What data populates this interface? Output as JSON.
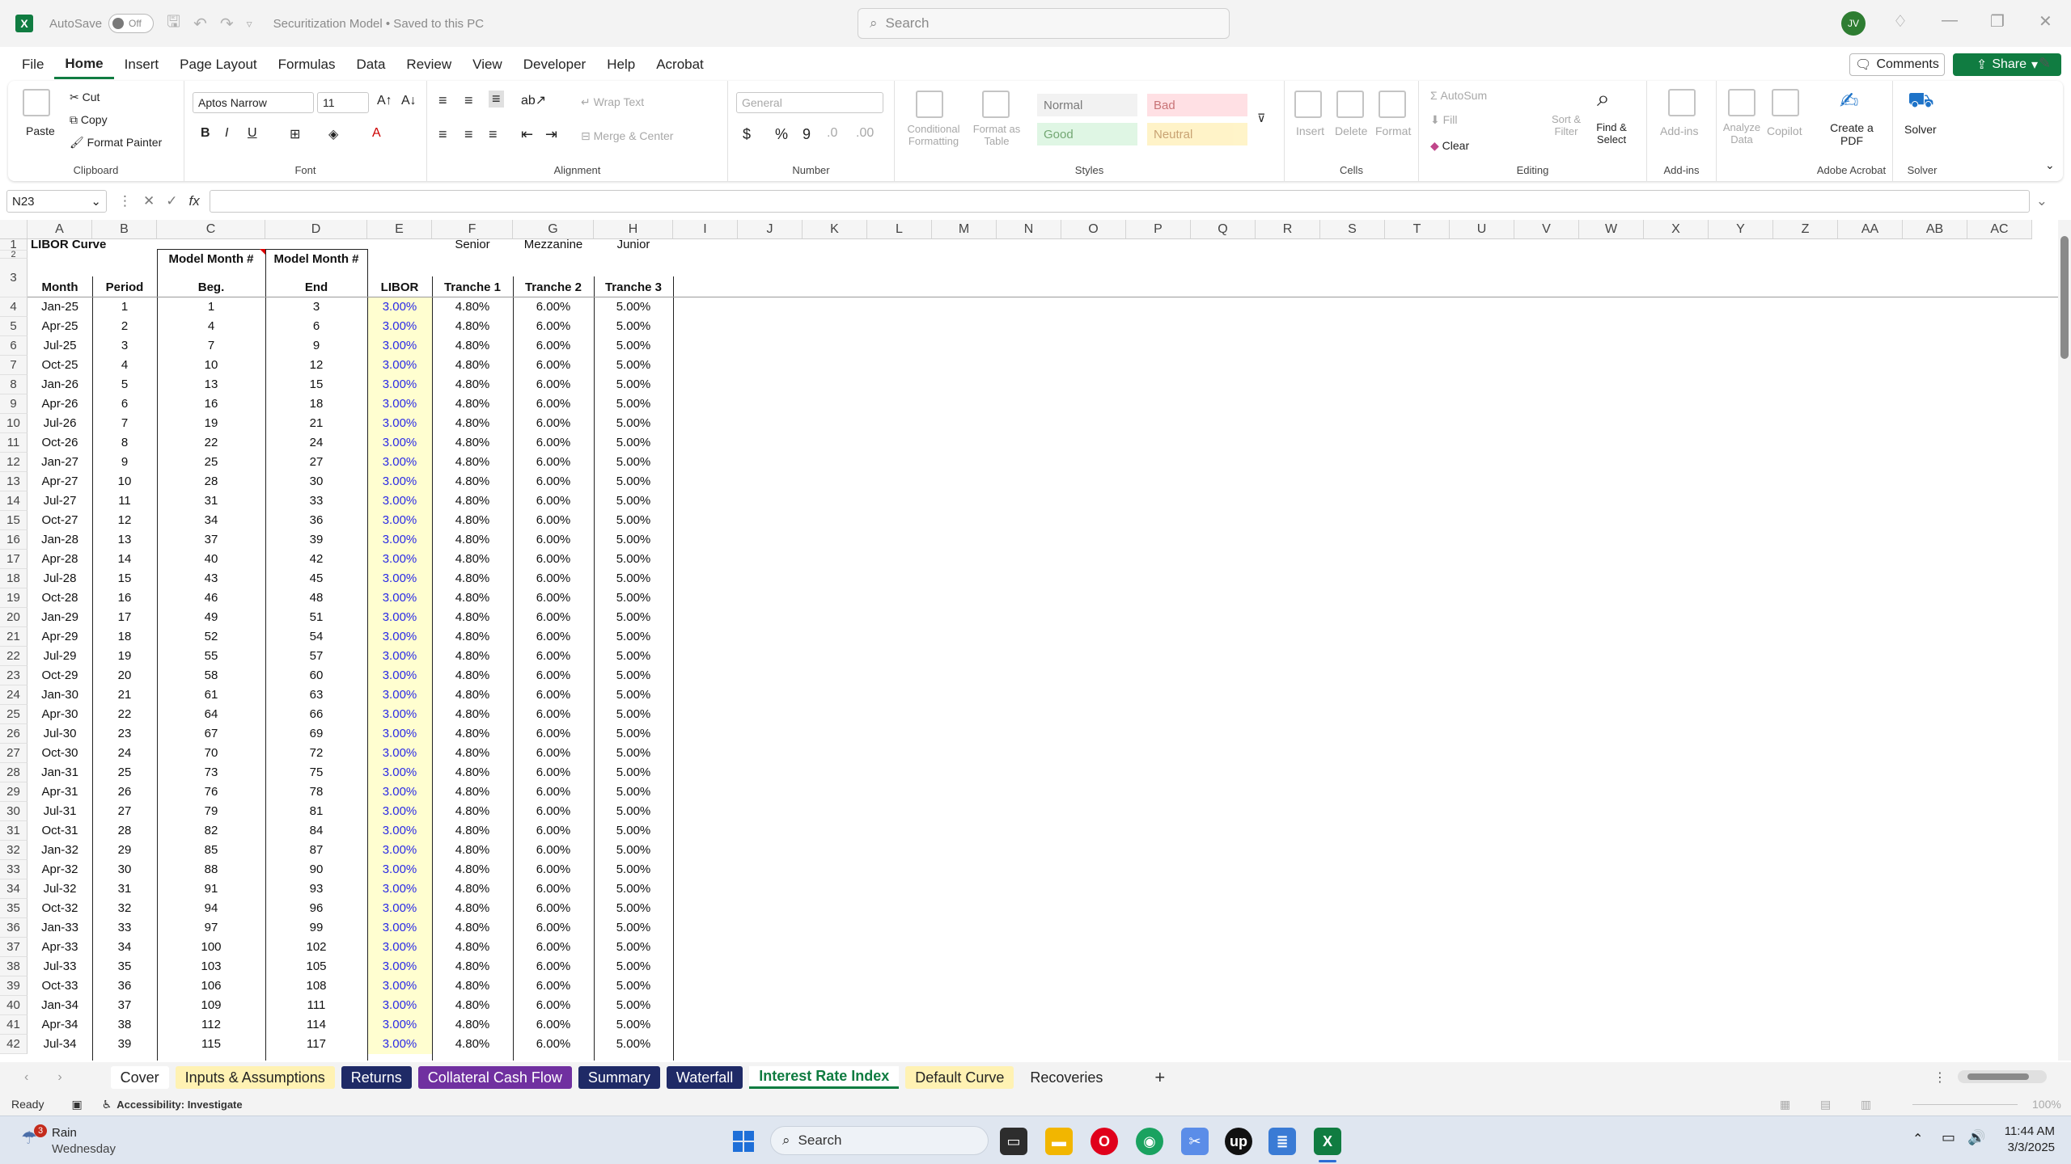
{
  "titlebar": {
    "autosave_label": "AutoSave",
    "autosave_state": "Off",
    "doc_title": "Securitization Model • Saved to this PC",
    "search_placeholder": "Search",
    "avatar_initials": "JV"
  },
  "menu": [
    "File",
    "Home",
    "Insert",
    "Page Layout",
    "Formulas",
    "Data",
    "Review",
    "View",
    "Developer",
    "Help",
    "Acrobat"
  ],
  "menu_active": "Home",
  "actions": {
    "comments": "Comments",
    "share": "Share"
  },
  "ribbon": {
    "clipboard": {
      "paste": "Paste",
      "cut": "Cut",
      "copy": "Copy",
      "format_painter": "Format Painter",
      "label": "Clipboard"
    },
    "font": {
      "name": "Aptos Narrow",
      "size": "11",
      "label": "Font"
    },
    "alignment": {
      "wrap": "Wrap Text",
      "merge": "Merge & Center",
      "label": "Alignment"
    },
    "number": {
      "format": "General",
      "label": "Number"
    },
    "styles": {
      "cond": "Conditional Formatting",
      "table": "Format as Table",
      "normal": "Normal",
      "bad": "Bad",
      "good": "Good",
      "neutral": "Neutral",
      "label": "Styles"
    },
    "cells": {
      "insert": "Insert",
      "delete": "Delete",
      "format": "Format",
      "label": "Cells"
    },
    "editing": {
      "autosum": "AutoSum",
      "fill": "Fill",
      "clear": "Clear",
      "sort": "Sort & Filter",
      "find": "Find & Select",
      "label": "Editing"
    },
    "addins": {
      "addins": "Add-ins",
      "label": "Add-ins"
    },
    "analysis": {
      "analyze": "Analyze Data",
      "copilot": "Copilot"
    },
    "acrobat": {
      "create": "Create a PDF",
      "label": "Adobe Acrobat"
    },
    "solver": {
      "solver": "Solver",
      "label": "Solver"
    }
  },
  "formula_bar": {
    "name_box": "N23",
    "fx": "fx",
    "formula": ""
  },
  "columns": [
    "A",
    "B",
    "C",
    "D",
    "E",
    "F",
    "G",
    "H",
    "I",
    "J",
    "K",
    "L",
    "M",
    "N",
    "O",
    "P",
    "Q",
    "R",
    "S",
    "T",
    "U",
    "V",
    "W",
    "X",
    "Y",
    "Z",
    "AA",
    "AB",
    "AC"
  ],
  "sheet": {
    "title": "LIBOR Curve",
    "tranche_groups": [
      "Senior",
      "Mezzanine",
      "Junior"
    ],
    "headers": {
      "month": "Month",
      "period": "Period",
      "beg_1": "Model Month #",
      "beg_2": "Beg.",
      "end_1": "Model Month #",
      "end_2": "End",
      "libor": "LIBOR",
      "t1": "Tranche 1",
      "t2": "Tranche 2",
      "t3": "Tranche 3"
    },
    "rows": [
      [
        "Jan-25",
        "1",
        "1",
        "3",
        "3.00%",
        "4.80%",
        "6.00%",
        "5.00%"
      ],
      [
        "Apr-25",
        "2",
        "4",
        "6",
        "3.00%",
        "4.80%",
        "6.00%",
        "5.00%"
      ],
      [
        "Jul-25",
        "3",
        "7",
        "9",
        "3.00%",
        "4.80%",
        "6.00%",
        "5.00%"
      ],
      [
        "Oct-25",
        "4",
        "10",
        "12",
        "3.00%",
        "4.80%",
        "6.00%",
        "5.00%"
      ],
      [
        "Jan-26",
        "5",
        "13",
        "15",
        "3.00%",
        "4.80%",
        "6.00%",
        "5.00%"
      ],
      [
        "Apr-26",
        "6",
        "16",
        "18",
        "3.00%",
        "4.80%",
        "6.00%",
        "5.00%"
      ],
      [
        "Jul-26",
        "7",
        "19",
        "21",
        "3.00%",
        "4.80%",
        "6.00%",
        "5.00%"
      ],
      [
        "Oct-26",
        "8",
        "22",
        "24",
        "3.00%",
        "4.80%",
        "6.00%",
        "5.00%"
      ],
      [
        "Jan-27",
        "9",
        "25",
        "27",
        "3.00%",
        "4.80%",
        "6.00%",
        "5.00%"
      ],
      [
        "Apr-27",
        "10",
        "28",
        "30",
        "3.00%",
        "4.80%",
        "6.00%",
        "5.00%"
      ],
      [
        "Jul-27",
        "11",
        "31",
        "33",
        "3.00%",
        "4.80%",
        "6.00%",
        "5.00%"
      ],
      [
        "Oct-27",
        "12",
        "34",
        "36",
        "3.00%",
        "4.80%",
        "6.00%",
        "5.00%"
      ],
      [
        "Jan-28",
        "13",
        "37",
        "39",
        "3.00%",
        "4.80%",
        "6.00%",
        "5.00%"
      ],
      [
        "Apr-28",
        "14",
        "40",
        "42",
        "3.00%",
        "4.80%",
        "6.00%",
        "5.00%"
      ],
      [
        "Jul-28",
        "15",
        "43",
        "45",
        "3.00%",
        "4.80%",
        "6.00%",
        "5.00%"
      ],
      [
        "Oct-28",
        "16",
        "46",
        "48",
        "3.00%",
        "4.80%",
        "6.00%",
        "5.00%"
      ],
      [
        "Jan-29",
        "17",
        "49",
        "51",
        "3.00%",
        "4.80%",
        "6.00%",
        "5.00%"
      ],
      [
        "Apr-29",
        "18",
        "52",
        "54",
        "3.00%",
        "4.80%",
        "6.00%",
        "5.00%"
      ],
      [
        "Jul-29",
        "19",
        "55",
        "57",
        "3.00%",
        "4.80%",
        "6.00%",
        "5.00%"
      ],
      [
        "Oct-29",
        "20",
        "58",
        "60",
        "3.00%",
        "4.80%",
        "6.00%",
        "5.00%"
      ],
      [
        "Jan-30",
        "21",
        "61",
        "63",
        "3.00%",
        "4.80%",
        "6.00%",
        "5.00%"
      ],
      [
        "Apr-30",
        "22",
        "64",
        "66",
        "3.00%",
        "4.80%",
        "6.00%",
        "5.00%"
      ],
      [
        "Jul-30",
        "23",
        "67",
        "69",
        "3.00%",
        "4.80%",
        "6.00%",
        "5.00%"
      ],
      [
        "Oct-30",
        "24",
        "70",
        "72",
        "3.00%",
        "4.80%",
        "6.00%",
        "5.00%"
      ],
      [
        "Jan-31",
        "25",
        "73",
        "75",
        "3.00%",
        "4.80%",
        "6.00%",
        "5.00%"
      ],
      [
        "Apr-31",
        "26",
        "76",
        "78",
        "3.00%",
        "4.80%",
        "6.00%",
        "5.00%"
      ],
      [
        "Jul-31",
        "27",
        "79",
        "81",
        "3.00%",
        "4.80%",
        "6.00%",
        "5.00%"
      ],
      [
        "Oct-31",
        "28",
        "82",
        "84",
        "3.00%",
        "4.80%",
        "6.00%",
        "5.00%"
      ],
      [
        "Jan-32",
        "29",
        "85",
        "87",
        "3.00%",
        "4.80%",
        "6.00%",
        "5.00%"
      ],
      [
        "Apr-32",
        "30",
        "88",
        "90",
        "3.00%",
        "4.80%",
        "6.00%",
        "5.00%"
      ],
      [
        "Jul-32",
        "31",
        "91",
        "93",
        "3.00%",
        "4.80%",
        "6.00%",
        "5.00%"
      ],
      [
        "Oct-32",
        "32",
        "94",
        "96",
        "3.00%",
        "4.80%",
        "6.00%",
        "5.00%"
      ],
      [
        "Jan-33",
        "33",
        "97",
        "99",
        "3.00%",
        "4.80%",
        "6.00%",
        "5.00%"
      ],
      [
        "Apr-33",
        "34",
        "100",
        "102",
        "3.00%",
        "4.80%",
        "6.00%",
        "5.00%"
      ],
      [
        "Jul-33",
        "35",
        "103",
        "105",
        "3.00%",
        "4.80%",
        "6.00%",
        "5.00%"
      ],
      [
        "Oct-33",
        "36",
        "106",
        "108",
        "3.00%",
        "4.80%",
        "6.00%",
        "5.00%"
      ],
      [
        "Jan-34",
        "37",
        "109",
        "111",
        "3.00%",
        "4.80%",
        "6.00%",
        "5.00%"
      ],
      [
        "Apr-34",
        "38",
        "112",
        "114",
        "3.00%",
        "4.80%",
        "6.00%",
        "5.00%"
      ],
      [
        "Jul-34",
        "39",
        "115",
        "117",
        "3.00%",
        "4.80%",
        "6.00%",
        "5.00%"
      ]
    ]
  },
  "tabs": [
    {
      "label": "Cover",
      "color": "#ffffff",
      "text": "#242424"
    },
    {
      "label": "Inputs & Assumptions",
      "color": "#fff2b3",
      "text": "#242424"
    },
    {
      "label": "Returns",
      "color": "#1f2a66",
      "text": "#ffffff"
    },
    {
      "label": "Collateral Cash Flow",
      "color": "#7030a0",
      "text": "#ffffff"
    },
    {
      "label": "Summary",
      "color": "#1f2a66",
      "text": "#ffffff"
    },
    {
      "label": "Waterfall",
      "color": "#1f2a66",
      "text": "#ffffff"
    },
    {
      "label": "Interest Rate Index",
      "color": "#ffffff",
      "text": "#107c41"
    },
    {
      "label": "Default Curve",
      "color": "#fff2b3",
      "text": "#242424"
    },
    {
      "label": "Recoveries",
      "color": "#f3f3f3",
      "text": "#242424"
    }
  ],
  "active_tab": "Interest Rate Index",
  "status": {
    "ready": "Ready",
    "accessibility": "Accessibility: Investigate",
    "zoom": "100%"
  },
  "taskbar": {
    "weather": "Rain",
    "weather_day": "Wednesday",
    "weather_badge": "3",
    "search": "Search",
    "time": "11:44 AM",
    "date": "3/3/2025"
  }
}
